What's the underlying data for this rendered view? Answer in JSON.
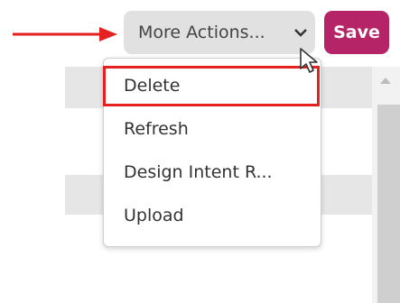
{
  "toolbar": {
    "more_actions_label": "More Actions...",
    "save_label": "Save"
  },
  "menu": {
    "items": [
      {
        "label": "Delete",
        "highlighted": true
      },
      {
        "label": "Refresh"
      },
      {
        "label": "Design Intent R..."
      },
      {
        "label": "Upload"
      }
    ]
  },
  "icons": {
    "annotation_arrow": "right-arrow-icon",
    "dropdown": "chevron-down-icon",
    "pointer": "mouse-cursor-icon",
    "scroll_up": "chevron-up-icon"
  },
  "colors": {
    "save_button": "#b52466",
    "annotation": "#e52020",
    "more_actions_button": "#e1e1e1"
  }
}
